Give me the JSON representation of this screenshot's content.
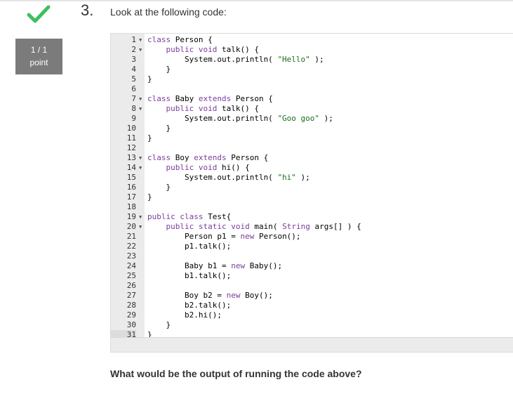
{
  "question": {
    "number": "3.",
    "prompt": "Look at the following code:",
    "output_prompt": "What would be the output of running the code above?"
  },
  "score": {
    "value": "1 / 1",
    "unit": "point"
  },
  "colors": {
    "check": "#3fbf5f",
    "score_bg": "#7b7b7b",
    "keyword": "#7a3e9d",
    "string": "#1a6d1a"
  },
  "code_lines": [
    {
      "n": "1",
      "fold": true,
      "text": "class Person {"
    },
    {
      "n": "2",
      "fold": true,
      "text": "    public void talk() {"
    },
    {
      "n": "3",
      "fold": false,
      "text": "        System.out.println( \"Hello\" );"
    },
    {
      "n": "4",
      "fold": false,
      "text": "    }"
    },
    {
      "n": "5",
      "fold": false,
      "text": "}"
    },
    {
      "n": "6",
      "fold": false,
      "text": ""
    },
    {
      "n": "7",
      "fold": true,
      "text": "class Baby extends Person {"
    },
    {
      "n": "8",
      "fold": true,
      "text": "    public void talk() {"
    },
    {
      "n": "9",
      "fold": false,
      "text": "        System.out.println( \"Goo goo\" );"
    },
    {
      "n": "10",
      "fold": false,
      "text": "    }"
    },
    {
      "n": "11",
      "fold": false,
      "text": "}"
    },
    {
      "n": "12",
      "fold": false,
      "text": ""
    },
    {
      "n": "13",
      "fold": true,
      "text": "class Boy extends Person {"
    },
    {
      "n": "14",
      "fold": true,
      "text": "    public void hi() {"
    },
    {
      "n": "15",
      "fold": false,
      "text": "        System.out.println( \"hi\" );"
    },
    {
      "n": "16",
      "fold": false,
      "text": "    }"
    },
    {
      "n": "17",
      "fold": false,
      "text": "}"
    },
    {
      "n": "18",
      "fold": false,
      "text": ""
    },
    {
      "n": "19",
      "fold": true,
      "text": "public class Test{"
    },
    {
      "n": "20",
      "fold": true,
      "text": "    public static void main( String args[] ) {"
    },
    {
      "n": "21",
      "fold": false,
      "text": "        Person p1 = new Person();"
    },
    {
      "n": "22",
      "fold": false,
      "text": "        p1.talk();"
    },
    {
      "n": "23",
      "fold": false,
      "text": ""
    },
    {
      "n": "24",
      "fold": false,
      "text": "        Baby b1 = new Baby();"
    },
    {
      "n": "25",
      "fold": false,
      "text": "        b1.talk();"
    },
    {
      "n": "26",
      "fold": false,
      "text": ""
    },
    {
      "n": "27",
      "fold": false,
      "text": "        Boy b2 = new Boy();"
    },
    {
      "n": "28",
      "fold": false,
      "text": "        b2.talk();"
    },
    {
      "n": "29",
      "fold": false,
      "text": "        b2.hi();"
    },
    {
      "n": "30",
      "fold": false,
      "text": "    }"
    },
    {
      "n": "31",
      "fold": false,
      "text": "}",
      "active": true
    }
  ]
}
